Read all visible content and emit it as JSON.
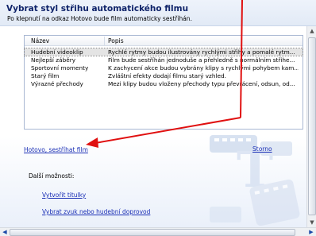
{
  "header": {
    "title": "Vybrat styl střihu automatického filmu",
    "subtitle": "Po klepnutí na odkaz Hotovo bude film automaticky sestříhán."
  },
  "table": {
    "columns": [
      "Název",
      "Popis"
    ],
    "rows": [
      {
        "name": "Hudební videoklip",
        "desc": "Rychlé rytmy budou ilustrovány rychlými střihy a pomalé rytm...",
        "selected": true
      },
      {
        "name": "Nejlepší záběry",
        "desc": "Film bude sestříhán jednoduše a přehledně s normálním střihe...",
        "selected": false
      },
      {
        "name": "Sportovní momenty",
        "desc": "K zachycení akce budou vybrány klipy s rychlými pohybem kam...",
        "selected": false
      },
      {
        "name": "Starý film",
        "desc": "Zvláštní efekty dodají filmu starý vzhled.",
        "selected": false
      },
      {
        "name": "Výrazné přechody",
        "desc": "Mezi klipy budou vloženy přechody typu převrácení, odsun, od...",
        "selected": false
      }
    ]
  },
  "actions": {
    "done_link": "Hotovo, sestříhat film",
    "cancel_link": "Storno"
  },
  "more_options": {
    "label": "Další možnosti:",
    "titles_link": "Vytvořit titulky",
    "audio_link": "Vybrat zvuk nebo hudební doprovod"
  },
  "scrollbars": {
    "up": "▲",
    "down": "▼",
    "left": "◀",
    "right": "▶"
  },
  "colors": {
    "title": "#10246a",
    "link": "#1a2fb5",
    "annotation_arrow": "#e01010"
  },
  "icons": [
    "movie-filmstrip-watermark-icon",
    "red-annotation-arrow"
  ]
}
